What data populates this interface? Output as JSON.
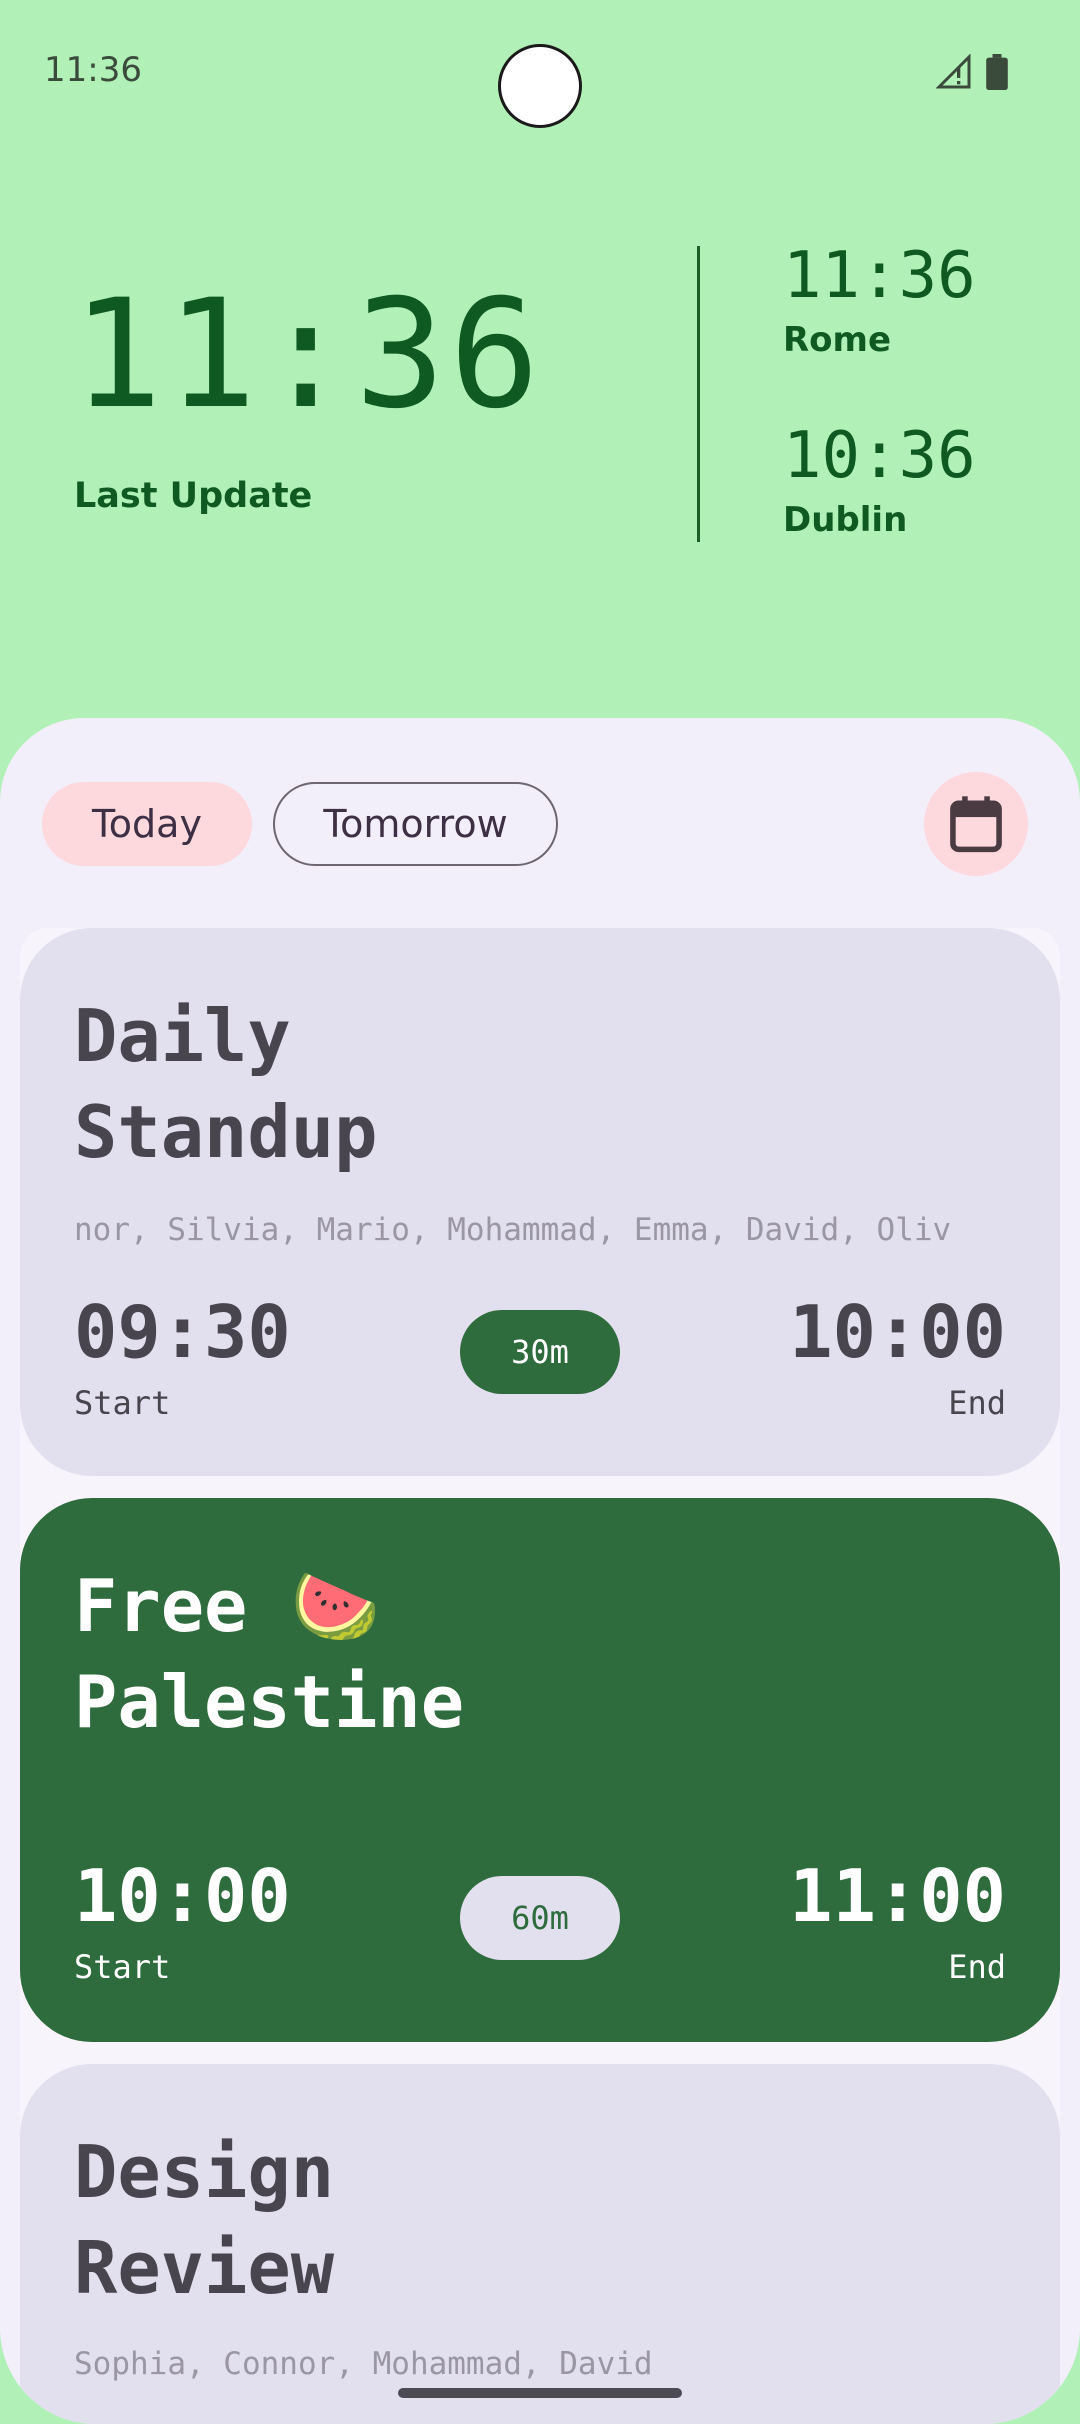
{
  "status_bar": {
    "time": "11:36"
  },
  "header": {
    "local_time": "11:36",
    "local_label": "Last Update",
    "zones": [
      {
        "time": "11:36",
        "city": "Rome"
      },
      {
        "time": "10:36",
        "city": "Dublin"
      }
    ]
  },
  "filters": {
    "today": "Today",
    "tomorrow": "Tomorrow"
  },
  "meetings": [
    {
      "title_line1": "Daily",
      "title_line2": "Standup",
      "attendees": "nor, Silvia, Mario, Mohammad, Emma, David, Oliv",
      "start": "09:30",
      "start_label": "Start",
      "duration": "30m",
      "end": "10:00",
      "end_label": "End"
    },
    {
      "title_line1": "Free 🍉",
      "title_line2": "Palestine",
      "start": "10:00",
      "start_label": "Start",
      "duration": "60m",
      "end": "11:00",
      "end_label": "End"
    },
    {
      "title_line1": "Design",
      "title_line2": "Review",
      "attendees": "Sophia, Connor, Mohammad, David"
    }
  ],
  "colors": {
    "header_bg": "#b1f1b7",
    "header_text": "#0f5a22",
    "sheet_bg": "#f3effa",
    "card_light": "#e2dfee",
    "card_dark": "#2e6b3d",
    "chip_active": "#fdd8dd"
  }
}
